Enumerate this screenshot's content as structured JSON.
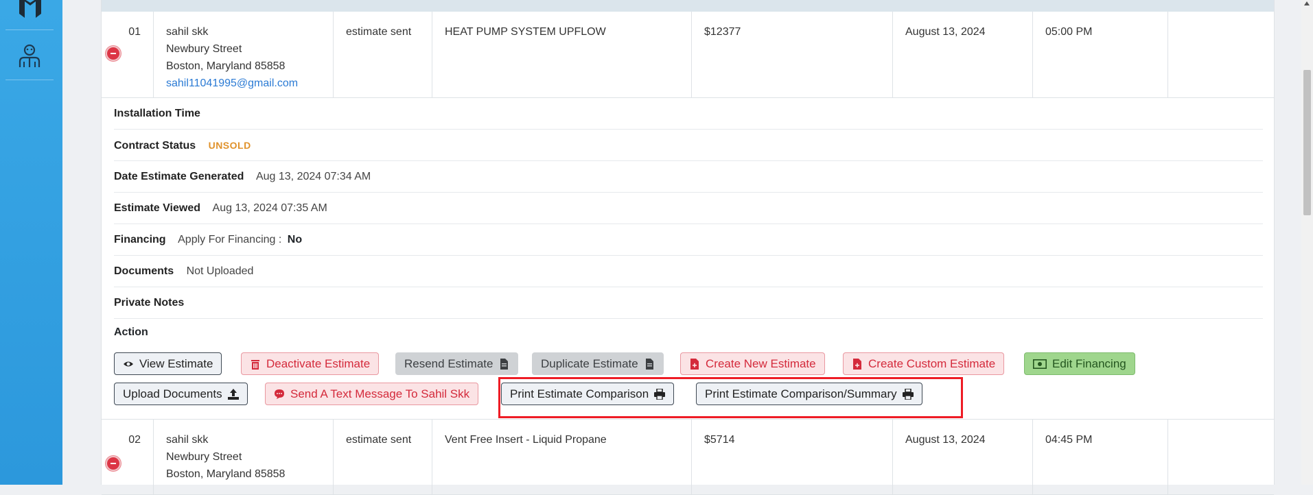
{
  "row1": {
    "num": "01",
    "customer": {
      "name": "sahil skk",
      "street": "Newbury Street",
      "city": "Boston, Maryland 85858",
      "email": "sahil11041995@gmail.com"
    },
    "status": "estimate sent",
    "product": "HEAT PUMP SYSTEM UPFLOW",
    "price": "$12377",
    "date": "August 13, 2024",
    "time": "05:00 PM"
  },
  "details": {
    "installation_time": {
      "label": "Installation Time",
      "value": ""
    },
    "contract_status": {
      "label": "Contract Status",
      "value": "UNSOLD"
    },
    "date_generated": {
      "label": "Date Estimate Generated",
      "value": "Aug 13, 2024 07:34 AM"
    },
    "estimate_viewed": {
      "label": "Estimate Viewed",
      "value": "Aug 13, 2024 07:35 AM"
    },
    "financing": {
      "label": "Financing",
      "apply_label": "Apply For Financing :",
      "apply_value": "No"
    },
    "documents": {
      "label": "Documents",
      "value": "Not Uploaded"
    },
    "private_notes": {
      "label": "Private Notes",
      "value": ""
    },
    "action": {
      "label": "Action"
    }
  },
  "actions": {
    "view_estimate": "View Estimate",
    "deactivate_estimate": "Deactivate Estimate",
    "resend_estimate": "Resend Estimate",
    "duplicate_estimate": "Duplicate Estimate",
    "create_new_estimate": "Create New Estimate",
    "create_custom_estimate": "Create Custom Estimate",
    "edit_financing": "Edit Financing",
    "upload_documents": "Upload Documents",
    "send_text": "Send A Text Message To Sahil Skk",
    "print_comparison": "Print Estimate Comparison",
    "print_comparison_summary": "Print Estimate Comparison/Summary"
  },
  "row2": {
    "num": "02",
    "customer": {
      "name": "sahil skk",
      "street": "Newbury Street",
      "city": "Boston, Maryland 85858"
    },
    "status": "estimate sent",
    "product": "Vent Free Insert - Liquid Propane",
    "price": "$5714",
    "date": "August 13, 2024",
    "time": "04:45 PM"
  },
  "colors": {
    "sidebar": "#3aa8e6",
    "danger": "#dc3545",
    "highlight": "#ee1c25",
    "unsold": "#e0922b",
    "link": "#2a7ad4"
  }
}
